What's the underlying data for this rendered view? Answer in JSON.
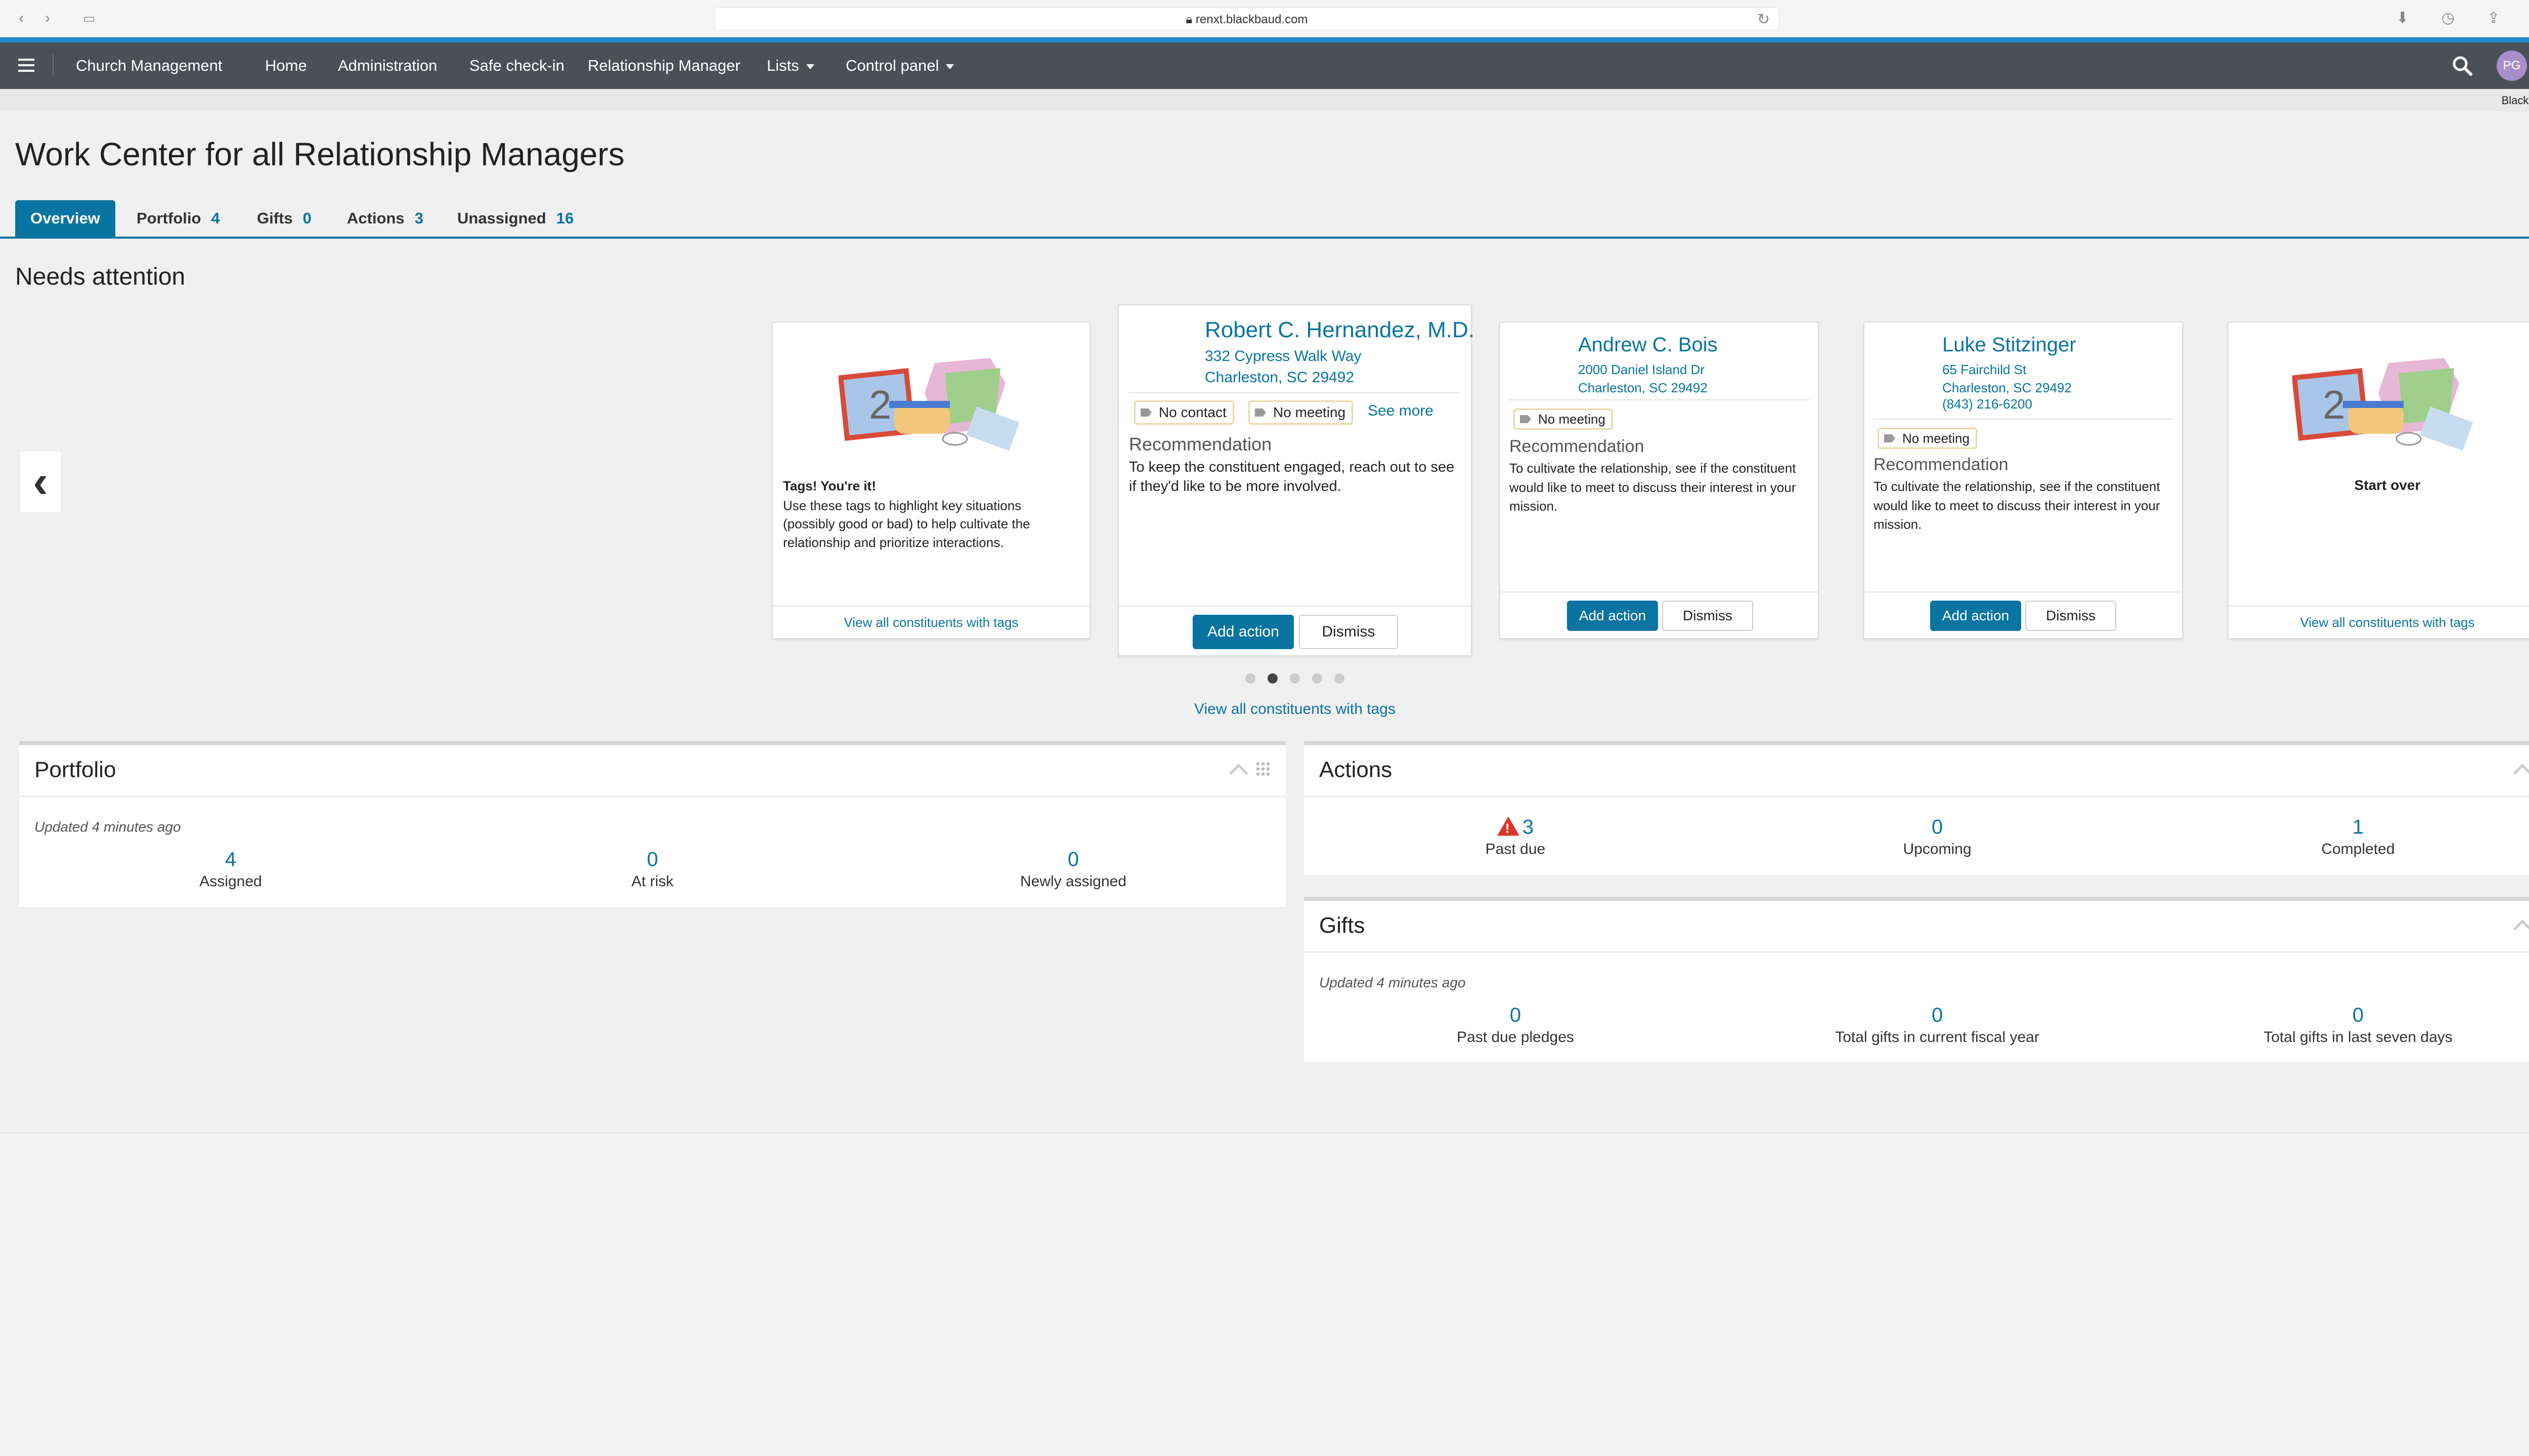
{
  "browser": {
    "url": "renxt.blackbaud.com"
  },
  "nav": {
    "brand": "Church Management",
    "items": [
      "Home",
      "Administration",
      "Safe check-in",
      "Relationship Manager",
      "Lists",
      "Control panel"
    ],
    "avatar": "PG",
    "org": "Blackbaud, Inc."
  },
  "page": {
    "title": "Work Center for all Relationship Managers"
  },
  "tabs": [
    {
      "label": "Overview",
      "count": ""
    },
    {
      "label": "Portfolio",
      "count": "4"
    },
    {
      "label": "Gifts",
      "count": "0"
    },
    {
      "label": "Actions",
      "count": "3"
    },
    {
      "label": "Unassigned",
      "count": "16"
    }
  ],
  "needs": {
    "title": "Needs attention",
    "view_all": "View all constituents with tags",
    "intro_card": {
      "heading": "Tags! You're it!",
      "text": "Use these tags to highlight key situations (possibly good or bad) to help cultivate the relationship and prioritize interactions.",
      "link": "View all constituents with tags"
    },
    "cards": [
      {
        "name": "Robert C. Hernandez, M.D.",
        "address1": "332 Cypress Walk Way",
        "address2": "Charleston, SC 29492",
        "tags": [
          "No contact",
          "No meeting"
        ],
        "see_more": "See more",
        "rec_heading": "Recommendation",
        "rec_text": "To keep the constituent engaged, reach out to see if they'd like to be more involved.",
        "add": "Add action",
        "dismiss": "Dismiss"
      },
      {
        "name": "Andrew C. Bois",
        "address1": "2000 Daniel Island Dr",
        "address2": "Charleston, SC 29492",
        "tags": [
          "No meeting"
        ],
        "rec_heading": "Recommendation",
        "rec_text": "To cultivate the relationship, see if the constituent would like to meet to discuss their interest in your mission.",
        "add": "Add action",
        "dismiss": "Dismiss"
      },
      {
        "name": "Luke Stitzinger",
        "address1": "65 Fairchild St",
        "address2": "Charleston, SC 29492",
        "phone": "(843) 216-6200",
        "tags": [
          "No meeting"
        ],
        "rec_heading": "Recommendation",
        "rec_text": "To cultivate the relationship, see if the constituent would like to meet to discuss their interest in your mission.",
        "add": "Add action",
        "dismiss": "Dismiss"
      }
    ],
    "end_card": {
      "heading": "Start over",
      "link": "View all constituents with tags"
    },
    "pager": {
      "count": 5,
      "active": 1
    }
  },
  "portfolio": {
    "title": "Portfolio",
    "updated": "Updated 4 minutes ago",
    "stats": [
      {
        "value": "4",
        "label": "Assigned"
      },
      {
        "value": "0",
        "label": "At risk"
      },
      {
        "value": "0",
        "label": "Newly assigned"
      }
    ]
  },
  "actions": {
    "title": "Actions",
    "stats": [
      {
        "value": "3",
        "label": "Past due",
        "warning": true
      },
      {
        "value": "0",
        "label": "Upcoming"
      },
      {
        "value": "1",
        "label": "Completed"
      }
    ]
  },
  "gifts": {
    "title": "Gifts",
    "updated": "Updated 4 minutes ago",
    "stats": [
      {
        "value": "0",
        "label": "Past due pledges"
      },
      {
        "value": "0",
        "label": "Total gifts in current fiscal year"
      },
      {
        "value": "0",
        "label": "Total gifts in last seven days"
      }
    ]
  }
}
